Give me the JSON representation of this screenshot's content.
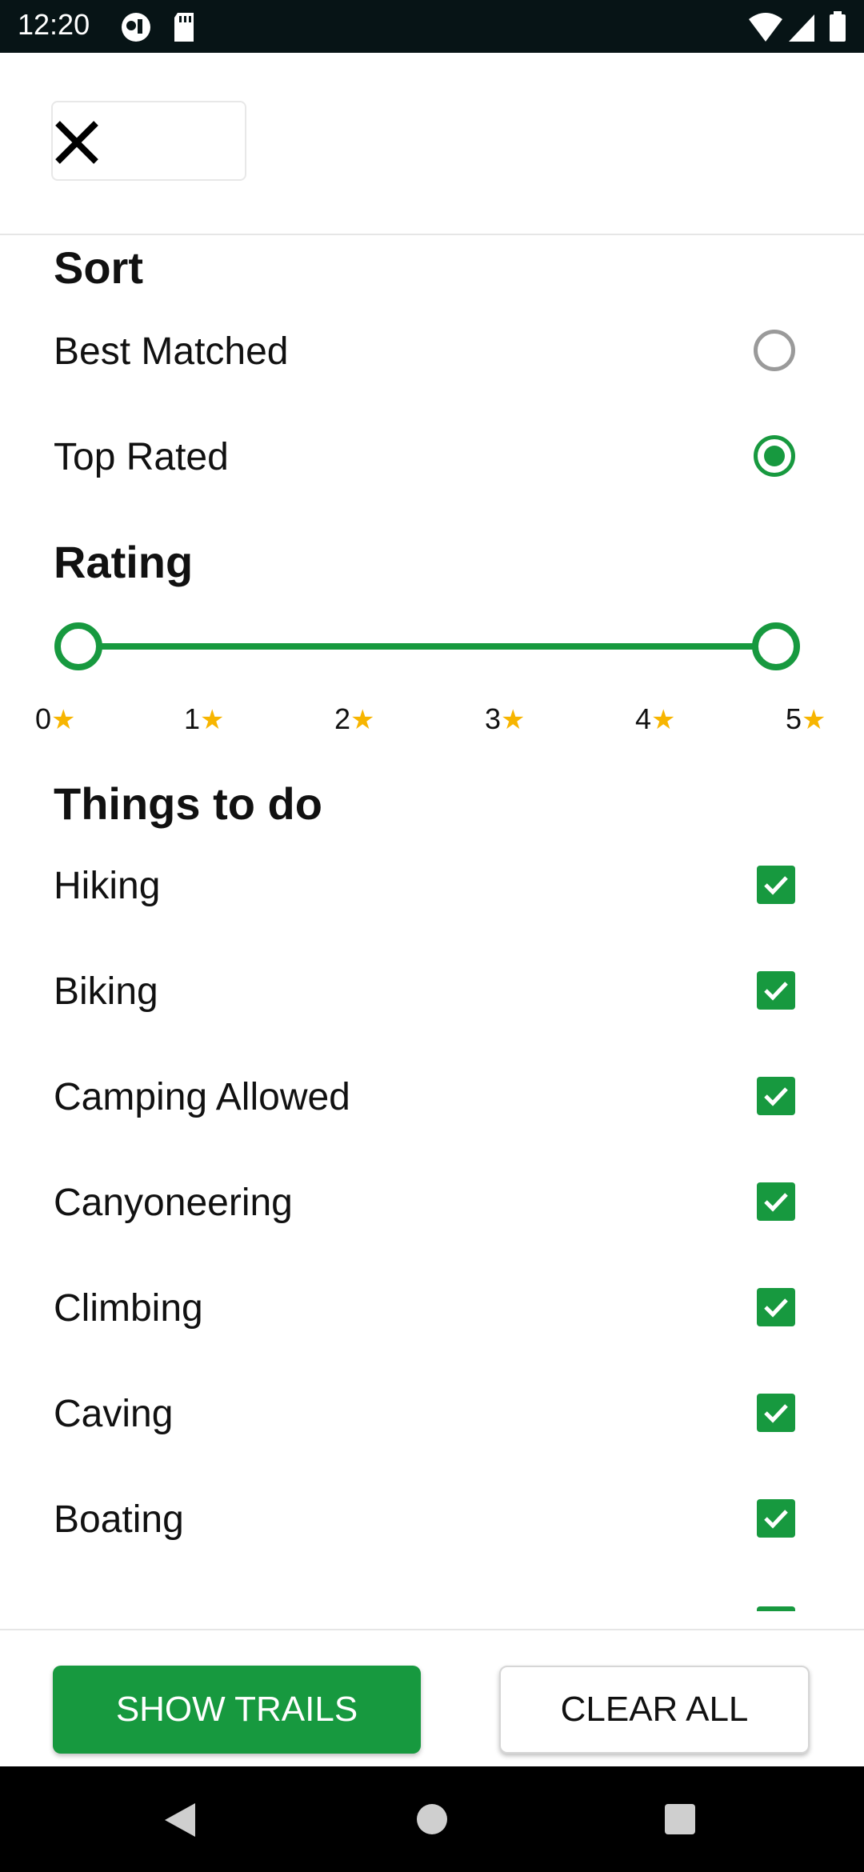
{
  "status_bar": {
    "time": "12:20"
  },
  "sort": {
    "title": "Sort",
    "options": [
      {
        "label": "Best Matched",
        "selected": false
      },
      {
        "label": "Top Rated",
        "selected": true
      }
    ]
  },
  "rating": {
    "title": "Rating",
    "min": 0,
    "max": 5,
    "selected_range": [
      0,
      5
    ],
    "ticks": [
      "0",
      "1",
      "2",
      "3",
      "4",
      "5"
    ]
  },
  "things_to_do": {
    "title": "Things to do",
    "items": [
      {
        "label": "Hiking",
        "checked": true
      },
      {
        "label": "Biking",
        "checked": true
      },
      {
        "label": "Camping Allowed",
        "checked": true
      },
      {
        "label": "Canyoneering",
        "checked": true
      },
      {
        "label": "Climbing",
        "checked": true
      },
      {
        "label": "Caving",
        "checked": true
      },
      {
        "label": "Boating",
        "checked": true
      }
    ]
  },
  "footer": {
    "show_trails": "SHOW TRAILS",
    "clear_all": "CLEAR ALL"
  },
  "colors": {
    "accent": "#17993f",
    "star": "#f7b500",
    "status_bar": "#071416"
  }
}
